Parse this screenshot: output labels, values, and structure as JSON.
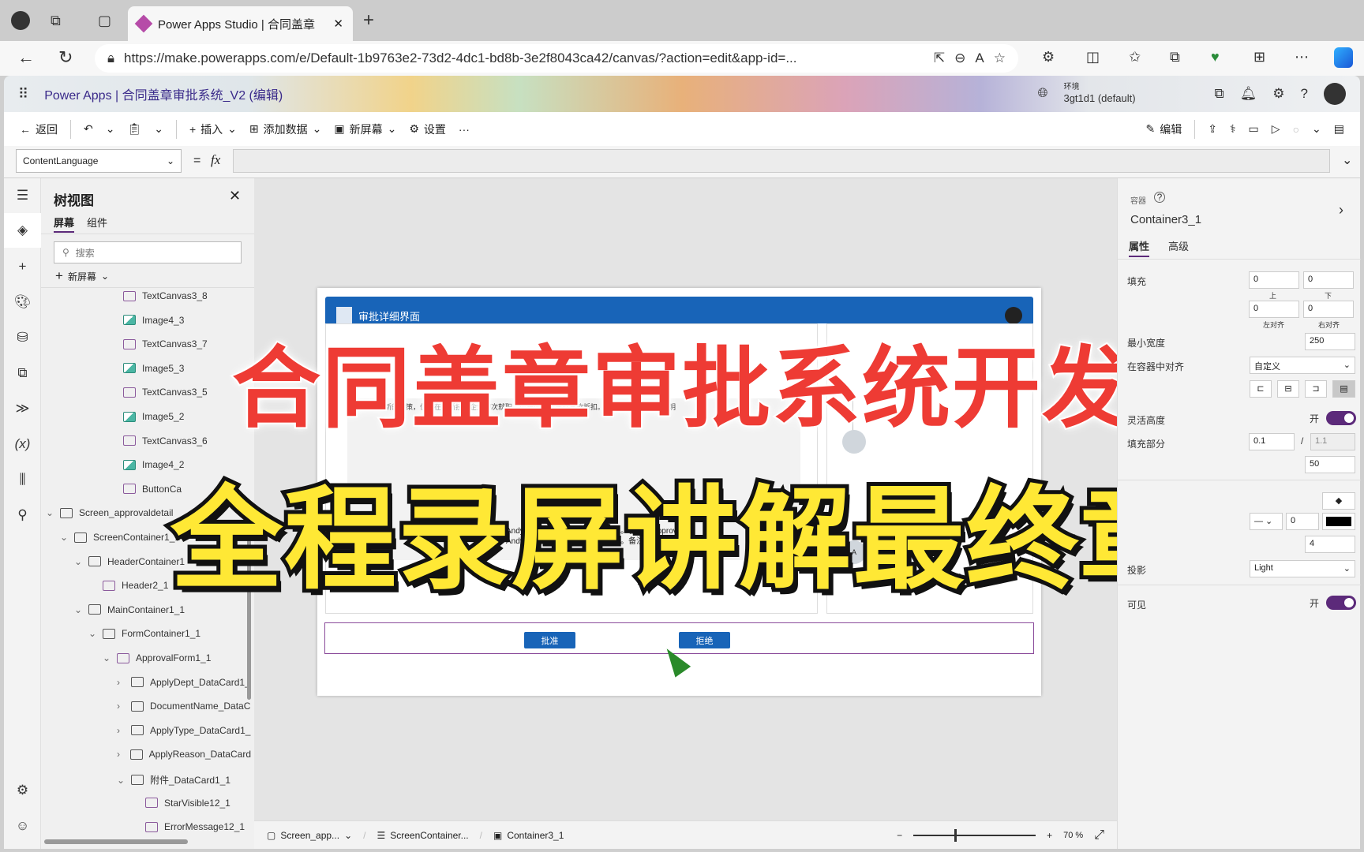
{
  "browser": {
    "tab_title": "Power Apps Studio | 合同盖章",
    "url": "https://make.powerapps.com/e/Default-1b9763e2-73d2-4dc1-bd8b-3e2f8043ca42/canvas/?action=edit&app-id=..."
  },
  "header": {
    "app": "Power Apps",
    "separator": "|",
    "title": "合同盖章审批系统_V2 (编辑)",
    "env_label": "环境",
    "env_value": "3gt1d1 (default)"
  },
  "commands": {
    "back": "返回",
    "insert": "插入",
    "add_data": "添加数据",
    "new_screen": "新屏幕",
    "settings": "设置",
    "more": "···",
    "edit": "编辑"
  },
  "formula": {
    "property": "ContentLanguage",
    "equals": "=",
    "fx": "fx",
    "value": ""
  },
  "tree": {
    "title": "树视图",
    "tabs": [
      "屏幕",
      "组件"
    ],
    "search_placeholder": "搜索",
    "new_screen": "新屏幕",
    "items": [
      {
        "label": "TextCanvas3_8",
        "icon": "text"
      },
      {
        "label": "Image4_3",
        "icon": "image"
      },
      {
        "label": "TextCanvas3_7",
        "icon": "text"
      },
      {
        "label": "Image5_3",
        "icon": "image"
      },
      {
        "label": "TextCanvas3_5",
        "icon": "text"
      },
      {
        "label": "Image5_2",
        "icon": "image"
      },
      {
        "label": "TextCanvas3_6",
        "icon": "text"
      },
      {
        "label": "Image4_2",
        "icon": "image"
      },
      {
        "label": "ButtonCa",
        "icon": "button"
      },
      {
        "label": "Screen_approvaldetail",
        "icon": "screen"
      },
      {
        "label": "ScreenContainer1_1",
        "icon": "vcontainer"
      },
      {
        "label": "HeaderContainer1",
        "icon": "hcontainer"
      },
      {
        "label": "Header2_1",
        "icon": "header"
      },
      {
        "label": "MainContainer1_1",
        "icon": "hcontainer"
      },
      {
        "label": "FormContainer1_1",
        "icon": "vcontainer"
      },
      {
        "label": "ApprovalForm1_1",
        "icon": "form"
      },
      {
        "label": "ApplyDept_DataCard1_",
        "icon": "card"
      },
      {
        "label": "DocumentName_DataC",
        "icon": "card"
      },
      {
        "label": "ApplyType_DataCard1_",
        "icon": "card"
      },
      {
        "label": "ApplyReason_DataCard",
        "icon": "card"
      },
      {
        "label": "附件_DataCard1_1",
        "icon": "card"
      },
      {
        "label": "StarVisible12_1",
        "icon": "edit"
      },
      {
        "label": "ErrorMessage12_1",
        "icon": "edit"
      }
    ]
  },
  "app_preview": {
    "header_title": "审批详细界面",
    "reason_text": "XX所在地新的政策，但凡在高新技术企业初次就职，可获得当地房屋贷款折扣。因此需要公司盖章证明",
    "history": [
      "Andy Zhuo 2024-06-14 审批完成。备注：Approved",
      "Andy Zhuo 2024-06-14 审批完成。备注：Approved"
    ],
    "approver_name": "Andy Zhuo",
    "approver_dept": "行政处",
    "approver_initial": "A",
    "approve": "批准",
    "reject": "拒绝"
  },
  "overlay": {
    "title": "合同盖章审批系统开发",
    "subtitle": "全程录屏讲解最终章"
  },
  "props": {
    "type": "容器",
    "name": "Container3_1",
    "tabs": [
      "属性",
      "高级"
    ],
    "padding_label": "填充",
    "pad_top": "0",
    "pad_bottom": "0",
    "pad_left": "0",
    "pad_right": "0",
    "top": "上",
    "bottom": "下",
    "left": "左对齐",
    "right": "右对齐",
    "min_width_label": "最小宽度",
    "min_width": "250",
    "align_label": "在容器中对齐",
    "align_value": "自定义",
    "flex_height_label": "灵活高度",
    "on": "开",
    "fill_label": "填充部分",
    "fill_value": "0.1",
    "fill_slash": "/",
    "fill_total": "1.1",
    "fill_extra": "50",
    "border_width": "0",
    "border_color": "#000000",
    "radius": "4",
    "shadow_label": "投影",
    "shadow_value": "Light",
    "visible_label": "可见"
  },
  "statusbar": {
    "screen": "Screen_app...",
    "container": "ScreenContainer...",
    "selected": "Container3_1",
    "zoom_minus": "−",
    "zoom_plus": "+",
    "zoom": "70",
    "zoom_unit": "%",
    "zoom_fraction": 0.7
  },
  "colors": {
    "accent": "#5c2a7a",
    "app_blue": "#1864b8",
    "overlay_red": "#ee3b34",
    "overlay_yellow": "#ffe835"
  }
}
